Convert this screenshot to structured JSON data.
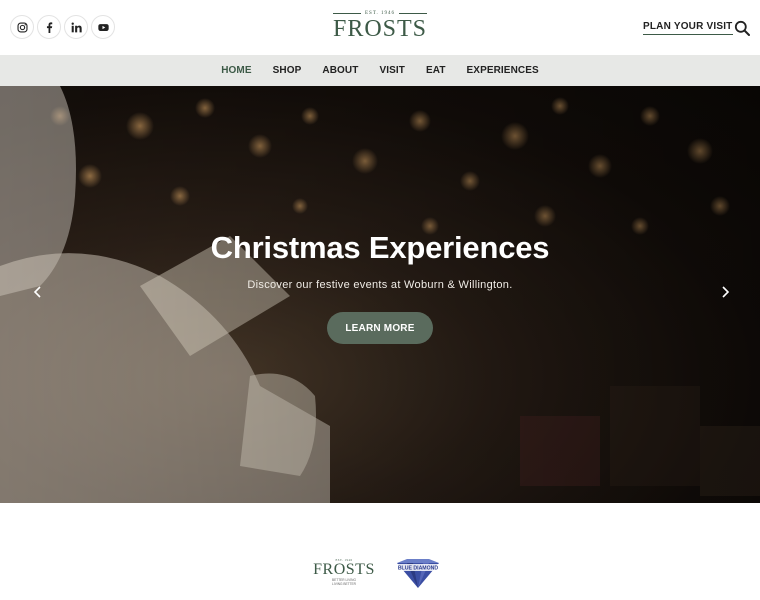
{
  "header": {
    "logo": {
      "est": "EST. 1946",
      "name": "FROSTS"
    },
    "plan_visit": "PLAN YOUR VISIT",
    "socials": [
      "instagram-icon",
      "facebook-icon",
      "linkedin-icon",
      "youtube-icon"
    ]
  },
  "nav": {
    "items": [
      {
        "label": "HOME"
      },
      {
        "label": "SHOP"
      },
      {
        "label": "ABOUT"
      },
      {
        "label": "VISIT"
      },
      {
        "label": "EAT"
      },
      {
        "label": "EXPERIENCES"
      }
    ],
    "active_index": 0
  },
  "hero": {
    "title": "Christmas Experiences",
    "subtitle": "Discover our festive events at Woburn & Willington.",
    "button": "LEARN MORE"
  },
  "brands": {
    "frosts": {
      "est": "EST. 1946",
      "name": "FROSTS",
      "tagline_1": "BETTER LIVING",
      "tagline_2": "LIVING BETTER"
    },
    "blue_diamond": {
      "name": "BLUE DIAMOND"
    }
  },
  "colors": {
    "brand_green": "#3d5a47",
    "nav_bg": "#e7e8e6",
    "button_bg": "#5a6b5d",
    "diamond_blue": "#2f3f8f"
  }
}
